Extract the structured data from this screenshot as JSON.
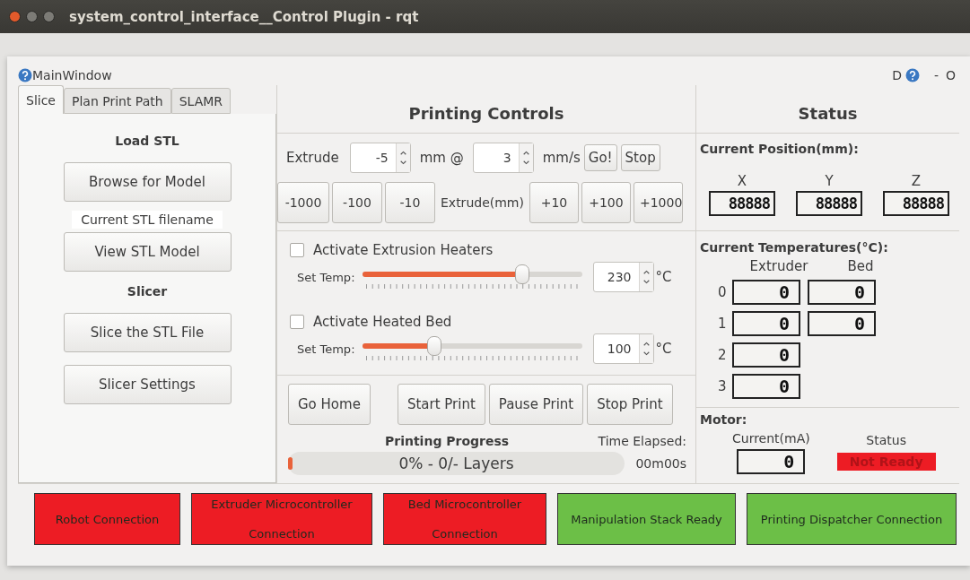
{
  "window": {
    "title": "system_control_interface__Control Plugin - rqt"
  },
  "plugin": {
    "title": "MainWindow",
    "right_controls": [
      "D",
      "-",
      "O"
    ]
  },
  "tabs": [
    {
      "label": "Slice",
      "selected": true
    },
    {
      "label": "Plan Print Path",
      "selected": false
    },
    {
      "label": "SLAMR",
      "selected": false
    }
  ],
  "slice_panel": [
    {
      "kind": "heading",
      "text": "Load STL"
    },
    {
      "kind": "button",
      "text": "Browse for Model"
    },
    {
      "kind": "label",
      "text": "Current STL filename"
    },
    {
      "kind": "button",
      "text": "View STL Model"
    },
    {
      "kind": "heading",
      "text": "Slicer"
    },
    {
      "kind": "button",
      "text": "Slice the STL File"
    },
    {
      "kind": "button",
      "text": "Slicer Settings"
    }
  ],
  "printing_controls": {
    "title": "Printing Controls",
    "extrude": {
      "label": "Extrude",
      "amount": "-5",
      "amount_unit": "mm @",
      "speed": "3",
      "speed_unit": "mm/s",
      "buttons": [
        "Go!",
        "Stop"
      ]
    },
    "jog_minus": [
      "-1000",
      "-100",
      "-10"
    ],
    "jog_label": "Extrude(mm)",
    "jog_plus": [
      "+10",
      "+100",
      "+1000"
    ],
    "heaters": [
      {
        "label": "Activate Extrusion Heaters",
        "checked": false,
        "set_label": "Set Temp:",
        "level": 0.73,
        "value": "230",
        "unit": "°C"
      },
      {
        "label": "Activate Heated Bed",
        "checked": false,
        "set_label": "Set Temp:",
        "level": 0.33,
        "value": "100",
        "unit": "°C"
      }
    ],
    "actions": [
      "Go Home",
      "Start Print",
      "Pause Print",
      "Stop Print"
    ],
    "progress": {
      "title": "Printing Progress",
      "level": 0.01,
      "text": "0% - 0/- Layers"
    },
    "time": {
      "label": "Time Elapsed:",
      "value": "00m00s"
    }
  },
  "status": {
    "title": "Status",
    "position": {
      "title": "Current Position(mm):",
      "axes": [
        {
          "label": "X",
          "value": "88888"
        },
        {
          "label": "Y",
          "value": "88888"
        },
        {
          "label": "Z",
          "value": "88888"
        }
      ]
    },
    "temperatures": {
      "title": "Current Temperatures(°C):",
      "columns": [
        "Extruder",
        "Bed"
      ],
      "rows": [
        {
          "index": "0",
          "values": [
            "0",
            "0"
          ]
        },
        {
          "index": "1",
          "values": [
            "0",
            "0"
          ]
        },
        {
          "index": "2",
          "values": [
            "0"
          ]
        },
        {
          "index": "3",
          "values": [
            "0"
          ]
        }
      ]
    },
    "motor": {
      "title": "Motor:",
      "current_label": "Current(mA)",
      "current": "0",
      "status_label": "Status",
      "status": {
        "text": "Not Ready",
        "color": "#ed1c24"
      }
    }
  },
  "indicators": [
    {
      "text": "Robot Connection",
      "color": "#ed1c24"
    },
    {
      "text": "Extruder Microcontroller Connection",
      "color": "#ed1c24"
    },
    {
      "text": "Bed Microcontroller Connection",
      "color": "#ed1c24"
    },
    {
      "text": "Manipulation Stack Ready",
      "color": "#6cbf47"
    },
    {
      "text": "Printing Dispatcher Connection",
      "color": "#6cbf47"
    }
  ]
}
